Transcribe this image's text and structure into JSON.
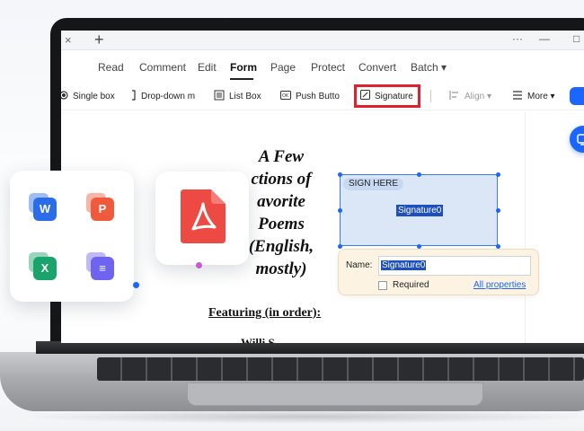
{
  "window": {
    "tab_close_glyph": "×",
    "tab_add_glyph": "+",
    "more_glyph": "···",
    "minimize_glyph": "—",
    "maximize_glyph": "□"
  },
  "menu": {
    "items": [
      "Read",
      "Comment",
      "Edit",
      "Form",
      "Page",
      "Protect",
      "Convert",
      "Batch ▾"
    ],
    "active": "Form"
  },
  "toolbar": {
    "single_box": "Single box",
    "drop_down": "Drop-down m",
    "list_box": "List Box",
    "push_button": "Push Butto",
    "signature": "Signature",
    "align": "Align ▾",
    "more": "More ▾"
  },
  "document": {
    "title_lines": [
      "A Few",
      "ctions of",
      "avorite",
      "Poems",
      "(English,",
      "mostly)"
    ],
    "featuring": "Featuring (in order):",
    "cut_line": "Willi  S"
  },
  "signature_field": {
    "sign_here": "SIGN HERE",
    "field_name": "Signature0"
  },
  "properties": {
    "name_label": "Name:",
    "name_value": "Signature0",
    "required_label": "Required",
    "required_checked": false,
    "all_properties": "All properties"
  },
  "app_cards": {
    "word": {
      "letter": "W",
      "color": "#2b6de8"
    },
    "ppt": {
      "letter": "P",
      "color": "#f05a3c"
    },
    "excel": {
      "letter": "X",
      "color": "#1aa36b"
    },
    "other": {
      "letter": "≡",
      "color": "#6f64f0"
    },
    "pdf_color": "#ee4a44"
  },
  "colors": {
    "accent": "#1a66ff",
    "highlight": "#e0202d"
  }
}
